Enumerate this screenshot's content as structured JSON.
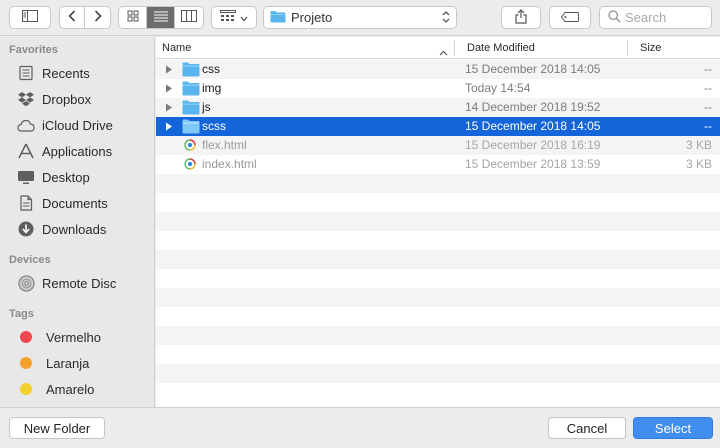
{
  "toolbar": {
    "path_label": "Projeto",
    "search_placeholder": "Search"
  },
  "sidebar": {
    "favorites_header": "Favorites",
    "favorites": [
      {
        "label": "Recents",
        "icon": "recents-icon"
      },
      {
        "label": "Dropbox",
        "icon": "dropbox-icon"
      },
      {
        "label": "iCloud Drive",
        "icon": "icloud-icon"
      },
      {
        "label": "Applications",
        "icon": "applications-icon"
      },
      {
        "label": "Desktop",
        "icon": "desktop-icon"
      },
      {
        "label": "Documents",
        "icon": "documents-icon"
      },
      {
        "label": "Downloads",
        "icon": "downloads-icon"
      }
    ],
    "devices_header": "Devices",
    "devices": [
      {
        "label": "Remote Disc",
        "icon": "disc-icon"
      }
    ],
    "tags_header": "Tags",
    "tags": [
      {
        "label": "Vermelho",
        "color": "#f0464f"
      },
      {
        "label": "Laranja",
        "color": "#f5a02d"
      },
      {
        "label": "Amarelo",
        "color": "#f3cf2f"
      }
    ]
  },
  "columns": {
    "name": "Name",
    "date": "Date Modified",
    "size": "Size"
  },
  "files": [
    {
      "name": "css",
      "date": "15 December 2018 14:05",
      "size": "--",
      "kind": "folder"
    },
    {
      "name": "img",
      "date": "Today 14:54",
      "size": "--",
      "kind": "folder"
    },
    {
      "name": "js",
      "date": "14 December 2018 19:52",
      "size": "--",
      "kind": "folder"
    },
    {
      "name": "scss",
      "date": "15 December 2018 14:05",
      "size": "--",
      "kind": "folder",
      "selected": true
    },
    {
      "name": "flex.html",
      "date": "15 December 2018 16:19",
      "size": "3 KB",
      "kind": "html"
    },
    {
      "name": "index.html",
      "date": "15 December 2018 13:59",
      "size": "3 KB",
      "kind": "html"
    }
  ],
  "footer": {
    "new_folder": "New Folder",
    "cancel": "Cancel",
    "select": "Select"
  },
  "colors": {
    "selection": "#1565da",
    "folder": "#5ab4ee",
    "primary_button": "#3f8ef0"
  }
}
